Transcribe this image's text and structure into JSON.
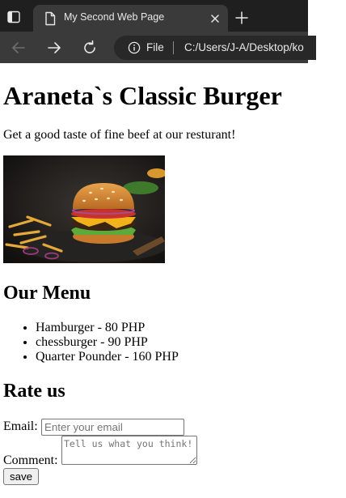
{
  "browser": {
    "tab": {
      "title": "My Second Web Page",
      "icon": "page-icon",
      "close_icon": "close-icon"
    },
    "toolbar": {
      "back_icon": "arrow-left-icon",
      "forward_icon": "arrow-right-icon",
      "reload_icon": "reload-icon",
      "address": {
        "info_icon": "info-icon",
        "scheme_label": "File",
        "url": "C:/Users/J-A/Desktop/ko"
      }
    },
    "new_tab_icon": "plus-icon"
  },
  "page": {
    "title": "Araneta`s Classic Burger",
    "tagline": "Get a good taste of fine beef at our resturant!",
    "image": {
      "alt": "Burger"
    },
    "menu": {
      "heading": "Our Menu",
      "items": [
        "Hamburger - 80 PHP",
        "chessburger - 90 PHP",
        "Quarter Pounder - 160 PHP"
      ]
    },
    "rate": {
      "heading": "Rate us",
      "email_label": "Email:",
      "email_placeholder": "Enter your email",
      "comment_label": "Comment:",
      "comment_placeholder": "Tell us what you think!",
      "save_label": "save"
    }
  },
  "colors": {
    "chrome_dark": "#1f1f1f",
    "chrome_tab": "#3a3a3a",
    "address_bar": "#282828",
    "chrome_text": "#e8e8e8",
    "page_background": "#ffffff"
  }
}
